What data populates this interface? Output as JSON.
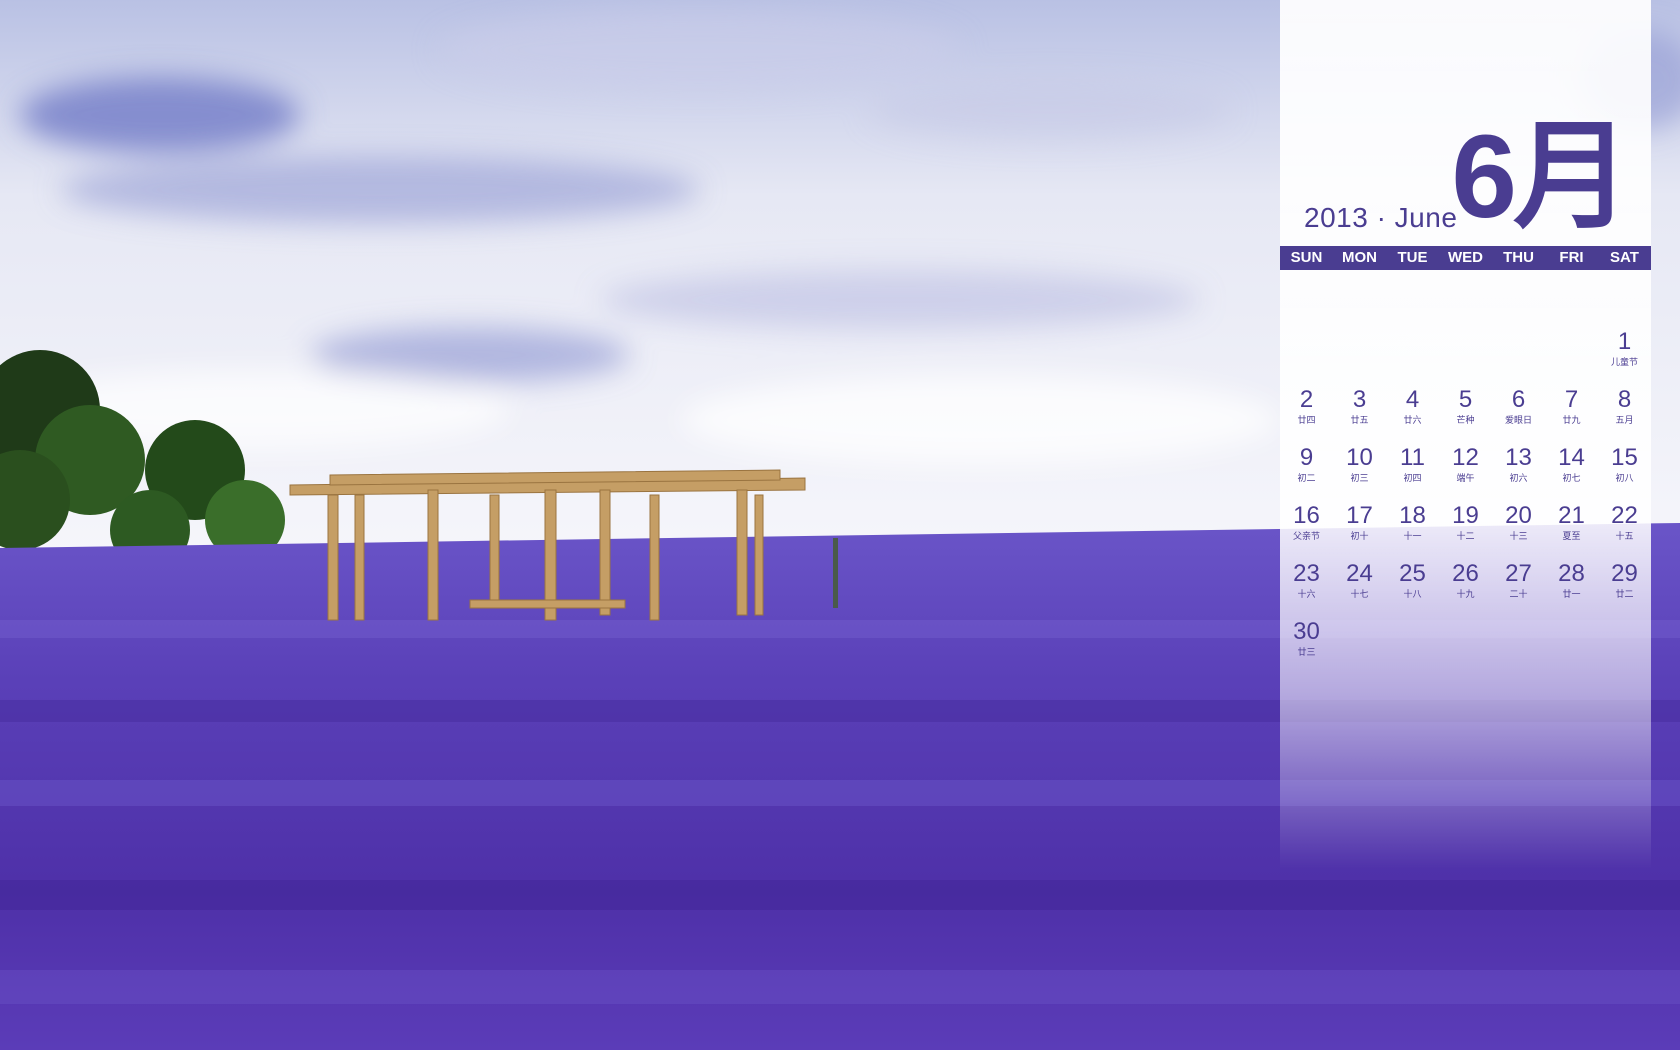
{
  "calendar": {
    "year_line": "2013 · June",
    "month_big": "6月",
    "weekdays": [
      "SUN",
      "MON",
      "TUE",
      "WED",
      "THU",
      "FRI",
      "SAT"
    ],
    "weeks": [
      [
        null,
        null,
        null,
        null,
        null,
        null,
        {
          "day": "1",
          "lunar": "儿童节"
        }
      ],
      [
        {
          "day": "2",
          "lunar": "廿四"
        },
        {
          "day": "3",
          "lunar": "廿五"
        },
        {
          "day": "4",
          "lunar": "廿六"
        },
        {
          "day": "5",
          "lunar": "芒种"
        },
        {
          "day": "6",
          "lunar": "爱眼日"
        },
        {
          "day": "7",
          "lunar": "廿九"
        },
        {
          "day": "8",
          "lunar": "五月"
        }
      ],
      [
        {
          "day": "9",
          "lunar": "初二"
        },
        {
          "day": "10",
          "lunar": "初三"
        },
        {
          "day": "11",
          "lunar": "初四"
        },
        {
          "day": "12",
          "lunar": "端午"
        },
        {
          "day": "13",
          "lunar": "初六"
        },
        {
          "day": "14",
          "lunar": "初七"
        },
        {
          "day": "15",
          "lunar": "初八"
        }
      ],
      [
        {
          "day": "16",
          "lunar": "父亲节"
        },
        {
          "day": "17",
          "lunar": "初十"
        },
        {
          "day": "18",
          "lunar": "十一"
        },
        {
          "day": "19",
          "lunar": "十二"
        },
        {
          "day": "20",
          "lunar": "十三"
        },
        {
          "day": "21",
          "lunar": "夏至"
        },
        {
          "day": "22",
          "lunar": "十五"
        }
      ],
      [
        {
          "day": "23",
          "lunar": "十六"
        },
        {
          "day": "24",
          "lunar": "十七"
        },
        {
          "day": "25",
          "lunar": "十八"
        },
        {
          "day": "26",
          "lunar": "十九"
        },
        {
          "day": "27",
          "lunar": "二十"
        },
        {
          "day": "28",
          "lunar": "廿一"
        },
        {
          "day": "29",
          "lunar": "廿二"
        }
      ],
      [
        {
          "day": "30",
          "lunar": "廿三"
        },
        null,
        null,
        null,
        null,
        null,
        null
      ]
    ]
  },
  "colors": {
    "accent": "#4a3d91",
    "lavender": "#5a3fb0",
    "sky": "#dfe3f3"
  }
}
